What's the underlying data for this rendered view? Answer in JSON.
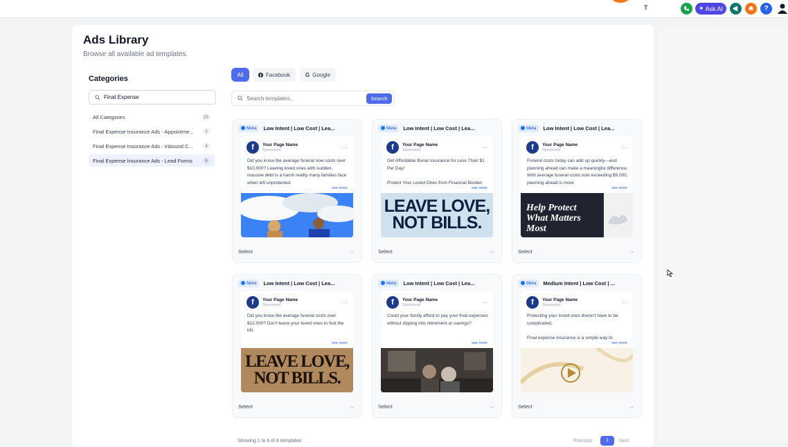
{
  "topbar": {
    "logo_text": "T",
    "ask_ai_label": "Ask AI",
    "help_glyph": "?"
  },
  "page": {
    "title": "Ads Library",
    "subtitle": "Browse all available ad templates."
  },
  "categories": {
    "heading": "Categories",
    "search_value": "Final Expense",
    "items": [
      {
        "label": "All Categories",
        "count": "25"
      },
      {
        "label": "Final Expense Insurance Ads - Appointme...",
        "count": "2"
      },
      {
        "label": "Final Expense Insurance Ads - Inbound C...",
        "count": "4"
      },
      {
        "label": "Final Expense Insurance Ads - Lead Forms",
        "count": "6"
      }
    ]
  },
  "filters": {
    "all": "All",
    "facebook": "Facebook",
    "google": "Google"
  },
  "search": {
    "placeholder": "Search templates...",
    "button": "Search"
  },
  "card_common": {
    "platform": "Meta",
    "page_name": "Your Page Name",
    "sponsored": "Sponsored",
    "see_more": "see more",
    "select_label": "Select",
    "fb_glyph": "f"
  },
  "cards": [
    {
      "title": "Low Intent | Low Cost | Lea...",
      "text": "Did you know the average funeral now costs over $10,000? Leaving loved ones with sudden, massive debt is a harsh reality many families face when left unprotected.",
      "image_text": []
    },
    {
      "title": "Low Intent | Low Cost | Lea...",
      "text": "Get Affordable Burial Insurance for Less Than $1 Per Day!\n\nProtect Your Loved Ones from Financial Burden",
      "image_text": [
        "LEAVE LOVE,",
        "NOT BILLS."
      ]
    },
    {
      "title": "Low Intent | Low Cost | Lea...",
      "text": "Funeral costs today can add up quickly—and planning ahead can make a meaningful difference. With average funeral costs now exceeding $9,000, planning ahead is more",
      "image_text": [
        "Help Protect",
        "What Matters",
        "Most"
      ]
    },
    {
      "title": "Low Intent | Low Cost | Lea...",
      "text": "Did you know the average funeral costs over $12,000? Don't leave your loved ones to foot the bill.",
      "image_text": [
        "LEAVE LOVE,",
        "NOT BILLS."
      ]
    },
    {
      "title": "Low Intent | Low Cost | Lea...",
      "text": "Could your family afford to pay your final expenses without dipping into retirement or savings?",
      "image_text": []
    },
    {
      "title": "Medium Intent | Low Cost | ...",
      "text": "Protecting your loved ones doesn't have to be complicated.\n\nFinal expense insurance is a simple way to",
      "image_text": []
    }
  ],
  "pagination": {
    "summary": "Showing 1 to 6 of 6 templates",
    "previous": "Previous",
    "current": "1",
    "next": "Next"
  }
}
